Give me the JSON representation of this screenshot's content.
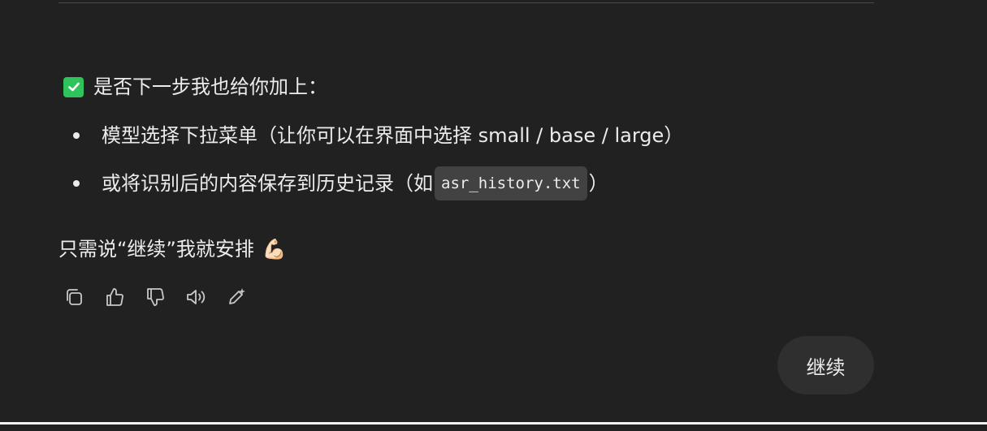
{
  "message": {
    "question": "是否下一步我也给你加上：",
    "options": [
      {
        "text_before": "模型选择下拉菜单（让你可以在界面中选择 small / base / large）",
        "code": "",
        "text_after": ""
      },
      {
        "text_before": "或将识别后的内容保存到历史记录（如 ",
        "code": "asr_history.txt",
        "text_after": "）"
      }
    ],
    "closing": "只需说“继续”我就安排",
    "closing_emoji": "💪🏻"
  },
  "actions": [
    {
      "name": "copy-icon"
    },
    {
      "name": "thumbs-up-icon"
    },
    {
      "name": "thumbs-down-icon"
    },
    {
      "name": "read-aloud-icon"
    },
    {
      "name": "edit-icon"
    }
  ],
  "suggestion": {
    "continue_label": "继续"
  },
  "colors": {
    "background": "#212121",
    "check_green": "#2fc45b",
    "code_bg": "#424242",
    "button_bg": "#2f2f2f"
  }
}
